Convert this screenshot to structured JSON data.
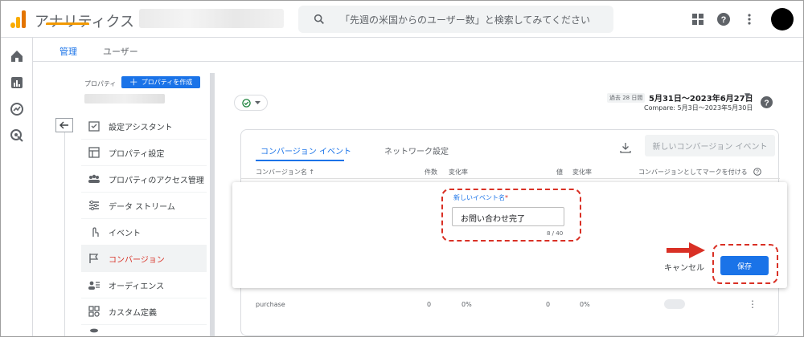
{
  "topbar": {
    "app_title": "アナリティクス",
    "search_placeholder": "「先週の米国からのユーザー数」と検索してみてください"
  },
  "admin_tabs": {
    "admin": "管理",
    "user": "ユーザー"
  },
  "property": {
    "label": "プロパティ",
    "create_button": "プロパティを作成"
  },
  "nav": {
    "items": [
      {
        "label": "設定アシスタント",
        "icon": "checklist-icon"
      },
      {
        "label": "プロパティ設定",
        "icon": "layout-icon"
      },
      {
        "label": "プロパティのアクセス管理",
        "icon": "people-icon"
      },
      {
        "label": "データ ストリーム",
        "icon": "stream-icon"
      },
      {
        "label": "イベント",
        "icon": "touch-icon"
      },
      {
        "label": "コンバージョン",
        "icon": "flag-icon"
      },
      {
        "label": "オーディエンス",
        "icon": "audience-icon"
      },
      {
        "label": "カスタム定義",
        "icon": "custom-definition-icon"
      }
    ]
  },
  "date_range": {
    "period_badge": "過去 28 日間",
    "main": "5月31日～2023年6月27日",
    "compare": "Compare: 5月3日～2023年5月30日"
  },
  "card": {
    "tabs": [
      "コンバージョン イベント",
      "ネットワーク設定"
    ],
    "new_button": "新しいコンバージョン イベント",
    "columns": {
      "name": "コンバージョン名 ↑",
      "count": "件数",
      "change": "変化率",
      "value": "値",
      "value_change": "変化率",
      "mark": "コンバージョンとしてマークを付ける"
    },
    "row": {
      "name": "purchase",
      "count": "0",
      "change": "0%",
      "value": "0",
      "value_change": "0%"
    }
  },
  "dialog": {
    "field_label": "新しいイベント名",
    "required_mark": "*",
    "field_value": "お問い合わせ完了",
    "counter": "8 / 40",
    "cancel": "キャンセル",
    "save": "保存"
  },
  "colors": {
    "accent_blue": "#1a73e8",
    "annotation_red": "#d93025",
    "ga_orange": "#f29900"
  }
}
